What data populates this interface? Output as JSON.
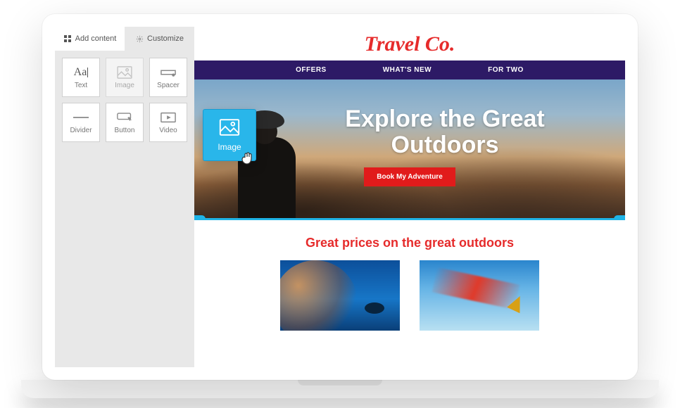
{
  "sidebar": {
    "tabs": {
      "add_content": "Add content",
      "customize": "Customize"
    },
    "blocks": [
      {
        "label": "Text",
        "icon": "text-icon"
      },
      {
        "label": "Image",
        "icon": "image-icon"
      },
      {
        "label": "Spacer",
        "icon": "spacer-icon"
      },
      {
        "label": "Divider",
        "icon": "divider-icon"
      },
      {
        "label": "Button",
        "icon": "button-icon"
      },
      {
        "label": "Video",
        "icon": "video-icon"
      }
    ]
  },
  "drag": {
    "label": "Image"
  },
  "preview": {
    "brand": "Travel Co.",
    "nav": [
      "OFFERS",
      "WHAT'S NEW",
      "FOR TWO"
    ],
    "hero": {
      "line1": "Explore the Great",
      "line2": "Outdoors",
      "cta": "Book My Adventure"
    },
    "subhead": "Great prices on the great outdoors"
  }
}
